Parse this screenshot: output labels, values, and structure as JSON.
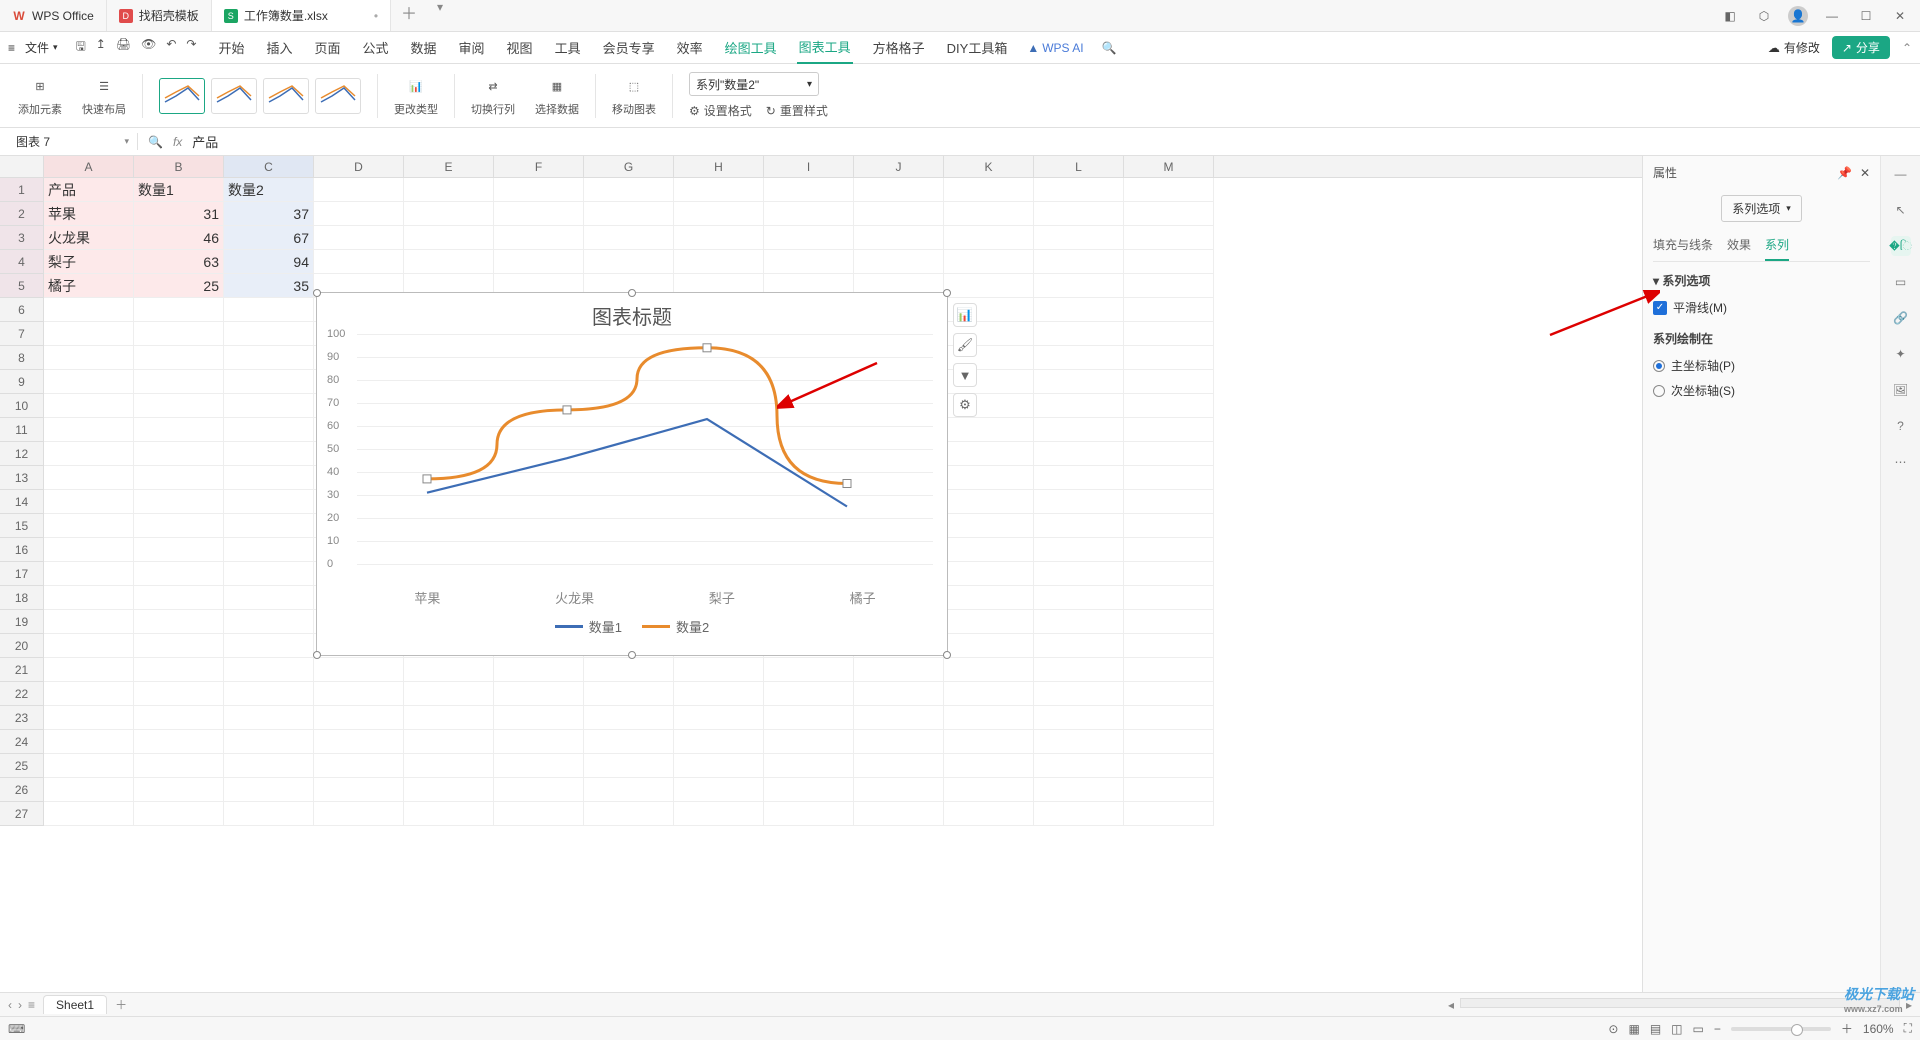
{
  "titlebar": {
    "app": "WPS Office",
    "tab_template": "找稻壳模板",
    "file_tab": "工作簿数量.xlsx"
  },
  "menubar": {
    "file": "文件",
    "tabs": [
      "开始",
      "插入",
      "页面",
      "公式",
      "数据",
      "审阅",
      "视图",
      "工具",
      "会员专享",
      "效率",
      "绘图工具",
      "图表工具",
      "方格格子",
      "DIY工具箱"
    ],
    "ai": "WPS AI",
    "save_hint": "有修改",
    "share": "分享"
  },
  "ribbon": {
    "add_element": "添加元素",
    "quick_layout": "快速布局",
    "change_type": "更改类型",
    "switch_rc": "切换行列",
    "select_data": "选择数据",
    "move_chart": "移动图表",
    "series_dd": "系列\"数量2\"",
    "set_format": "设置格式",
    "reset_style": "重置样式"
  },
  "formula": {
    "namebox": "图表 7",
    "fx": "产品"
  },
  "columns": [
    "A",
    "B",
    "C",
    "D",
    "E",
    "F",
    "G",
    "H",
    "I",
    "J",
    "K",
    "L",
    "M"
  ],
  "sheet_data": {
    "headers": [
      "产品",
      "数量1",
      "数量2"
    ],
    "rows": [
      {
        "p": "苹果",
        "q1": 31,
        "q2": 37
      },
      {
        "p": "火龙果",
        "q1": 46,
        "q2": 67
      },
      {
        "p": "梨子",
        "q1": 63,
        "q2": 94
      },
      {
        "p": "橘子",
        "q1": 25,
        "q2": 35
      }
    ]
  },
  "chart_data": {
    "type": "line",
    "title": "图表标题",
    "categories": [
      "苹果",
      "火龙果",
      "梨子",
      "橘子"
    ],
    "series": [
      {
        "name": "数量1",
        "values": [
          31,
          46,
          63,
          25
        ],
        "color": "#3d6db5"
      },
      {
        "name": "数量2",
        "values": [
          37,
          67,
          94,
          35
        ],
        "color": "#e88b2d",
        "smooth": true,
        "selected": true
      }
    ],
    "ylim": [
      0,
      100
    ],
    "ystep": 10,
    "xlabel": "",
    "ylabel": ""
  },
  "panel": {
    "title": "属性",
    "dd": "系列选项",
    "tabs": [
      "填充与线条",
      "效果",
      "系列"
    ],
    "section1": "系列选项",
    "smooth": "平滑线(M)",
    "section2": "系列绘制在",
    "primary": "主坐标轴(P)",
    "secondary": "次坐标轴(S)"
  },
  "sheettab": "Sheet1",
  "status": {
    "zoom": "160%"
  },
  "watermark": {
    "t": "极光下载站",
    "u": "www.xz7.com"
  }
}
